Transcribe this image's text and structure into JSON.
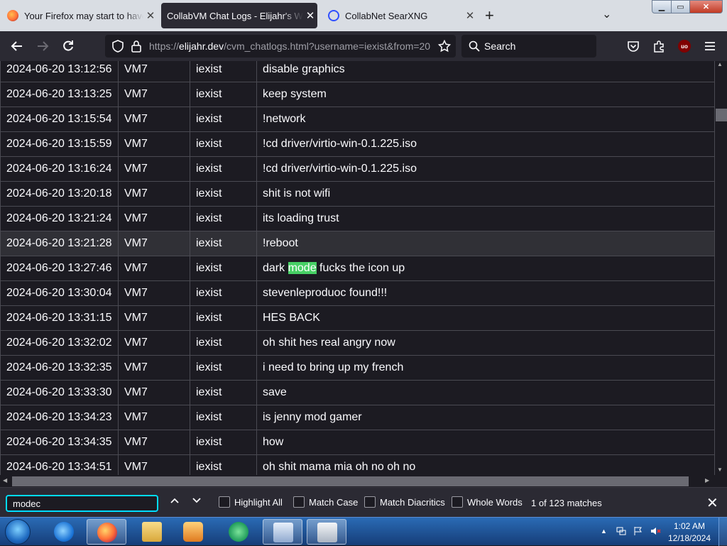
{
  "browser": {
    "tabs": [
      {
        "title": "Your Firefox may start to have p",
        "icon": "firefox-icon"
      },
      {
        "title": "CollabVM Chat Logs - Elijahr's Web",
        "icon": ""
      },
      {
        "title": "CollabNet SearXNG",
        "icon": "searxng-icon"
      }
    ],
    "tab_close_glyph": "✕",
    "new_tab_glyph": "+",
    "all_tabs_glyph": "⌄",
    "window_buttons": {
      "minimize": "▁",
      "maximize": "▭",
      "close": "✕"
    },
    "url_scheme": "https://",
    "url_host": "elijahr.dev",
    "url_rest": "/cvm_chatlogs.html?username=iexist&from=20",
    "search_placeholder": "Search",
    "extension_badge": "uo"
  },
  "chat_log": {
    "rows": [
      {
        "time": "2024-06-20 13:12:56",
        "vm": "VM7",
        "user": "iexist",
        "msg": "disable graphics"
      },
      {
        "time": "2024-06-20 13:13:25",
        "vm": "VM7",
        "user": "iexist",
        "msg": "keep system"
      },
      {
        "time": "2024-06-20 13:15:54",
        "vm": "VM7",
        "user": "iexist",
        "msg": "!network"
      },
      {
        "time": "2024-06-20 13:15:59",
        "vm": "VM7",
        "user": "iexist",
        "msg": "!cd driver/virtio-win-0.1.225.iso"
      },
      {
        "time": "2024-06-20 13:16:24",
        "vm": "VM7",
        "user": "iexist",
        "msg": "!cd driver/virtio-win-0.1.225.iso"
      },
      {
        "time": "2024-06-20 13:20:18",
        "vm": "VM7",
        "user": "iexist",
        "msg": "shit is not wifi"
      },
      {
        "time": "2024-06-20 13:21:24",
        "vm": "VM7",
        "user": "iexist",
        "msg": "its loading trust"
      },
      {
        "time": "2024-06-20 13:21:28",
        "vm": "VM7",
        "user": "iexist",
        "msg": "!reboot"
      },
      {
        "time": "2024-06-20 13:27:46",
        "vm": "VM7",
        "user": "iexist",
        "msg_before": "dark ",
        "msg_match": "mode",
        "msg_after": " fucks the icon up"
      },
      {
        "time": "2024-06-20 13:30:04",
        "vm": "VM7",
        "user": "iexist",
        "msg": "stevenleproduoc found!!!"
      },
      {
        "time": "2024-06-20 13:31:15",
        "vm": "VM7",
        "user": "iexist",
        "msg": "HES BACK"
      },
      {
        "time": "2024-06-20 13:32:02",
        "vm": "VM7",
        "user": "iexist",
        "msg": "oh shit hes real angry now"
      },
      {
        "time": "2024-06-20 13:32:35",
        "vm": "VM7",
        "user": "iexist",
        "msg": "i need to bring up my french"
      },
      {
        "time": "2024-06-20 13:33:30",
        "vm": "VM7",
        "user": "iexist",
        "msg": "save"
      },
      {
        "time": "2024-06-20 13:34:23",
        "vm": "VM7",
        "user": "iexist",
        "msg": "is jenny mod gamer"
      },
      {
        "time": "2024-06-20 13:34:35",
        "vm": "VM7",
        "user": "iexist",
        "msg": "how"
      },
      {
        "time": "2024-06-20 13:34:51",
        "vm": "VM7",
        "user": "iexist",
        "msg": "oh shit mama mia oh no oh no"
      }
    ],
    "hover_row_index": 7,
    "colors": {
      "match_highlight": "#47d065",
      "row_hover": "#303036"
    }
  },
  "find_bar": {
    "query": "modec",
    "prev_glyph": "∧",
    "next_glyph": "∨",
    "options": [
      {
        "id": "highlight-all",
        "label": "Highlight All",
        "checked": false
      },
      {
        "id": "match-case",
        "label": "Match Case",
        "checked": false
      },
      {
        "id": "match-diacritics",
        "label": "Match Diacritics",
        "checked": false
      },
      {
        "id": "whole-words",
        "label": "Whole Words",
        "checked": false
      }
    ],
    "status": "1 of 123 matches",
    "close_glyph": "✕"
  },
  "taskbar": {
    "apps": [
      "internet-explorer-icon",
      "firefox-icon",
      "file-explorer-icon",
      "media-player-icon",
      "media-center-icon",
      "control-panel-icon",
      "recycle-bin-icon"
    ],
    "active_app": "firefox-icon",
    "clock_time": "1:02 AM",
    "clock_date": "12/18/2024"
  }
}
